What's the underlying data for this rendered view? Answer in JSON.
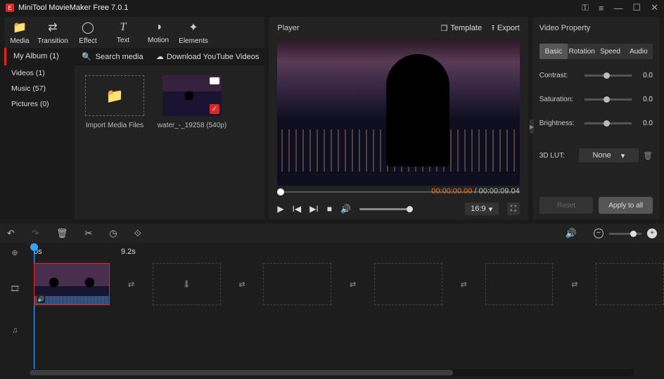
{
  "title": "MiniTool MovieMaker Free 7.0.1",
  "top_tabs": [
    {
      "label": "Media",
      "icon": "📁"
    },
    {
      "label": "Transition",
      "icon": "⇄"
    },
    {
      "label": "Effect",
      "icon": "◯"
    },
    {
      "label": "Text",
      "icon": "T"
    },
    {
      "label": "Motion",
      "icon": "◑"
    },
    {
      "label": "Elements",
      "icon": "✦"
    }
  ],
  "my_album": "My Album (1)",
  "search_placeholder": "Search media",
  "download_label": "Download YouTube Videos",
  "albums": [
    {
      "label": "Videos (1)"
    },
    {
      "label": "Music (57)"
    },
    {
      "label": "Pictures (0)"
    }
  ],
  "media": {
    "import_label": "Import Media Files",
    "clip_label": "water_-_19258 (540p)"
  },
  "player": {
    "title": "Player",
    "template": "Template",
    "export": "Export",
    "cur": "00:00:00.00",
    "dur": "00:00:09.04",
    "aspect": "16:9"
  },
  "props": {
    "title": "Video Property",
    "tabs": [
      "Basic",
      "Rotation",
      "Speed",
      "Audio"
    ],
    "rows": [
      {
        "label": "Contrast:",
        "val": "0.0"
      },
      {
        "label": "Saturation:",
        "val": "0.0"
      },
      {
        "label": "Brightness:",
        "val": "0.0"
      }
    ],
    "lut_label": "3D LUT:",
    "lut_value": "None",
    "reset": "Reset",
    "apply": "Apply to all"
  },
  "timeline": {
    "t0": "0s",
    "t1": "9.2s"
  }
}
